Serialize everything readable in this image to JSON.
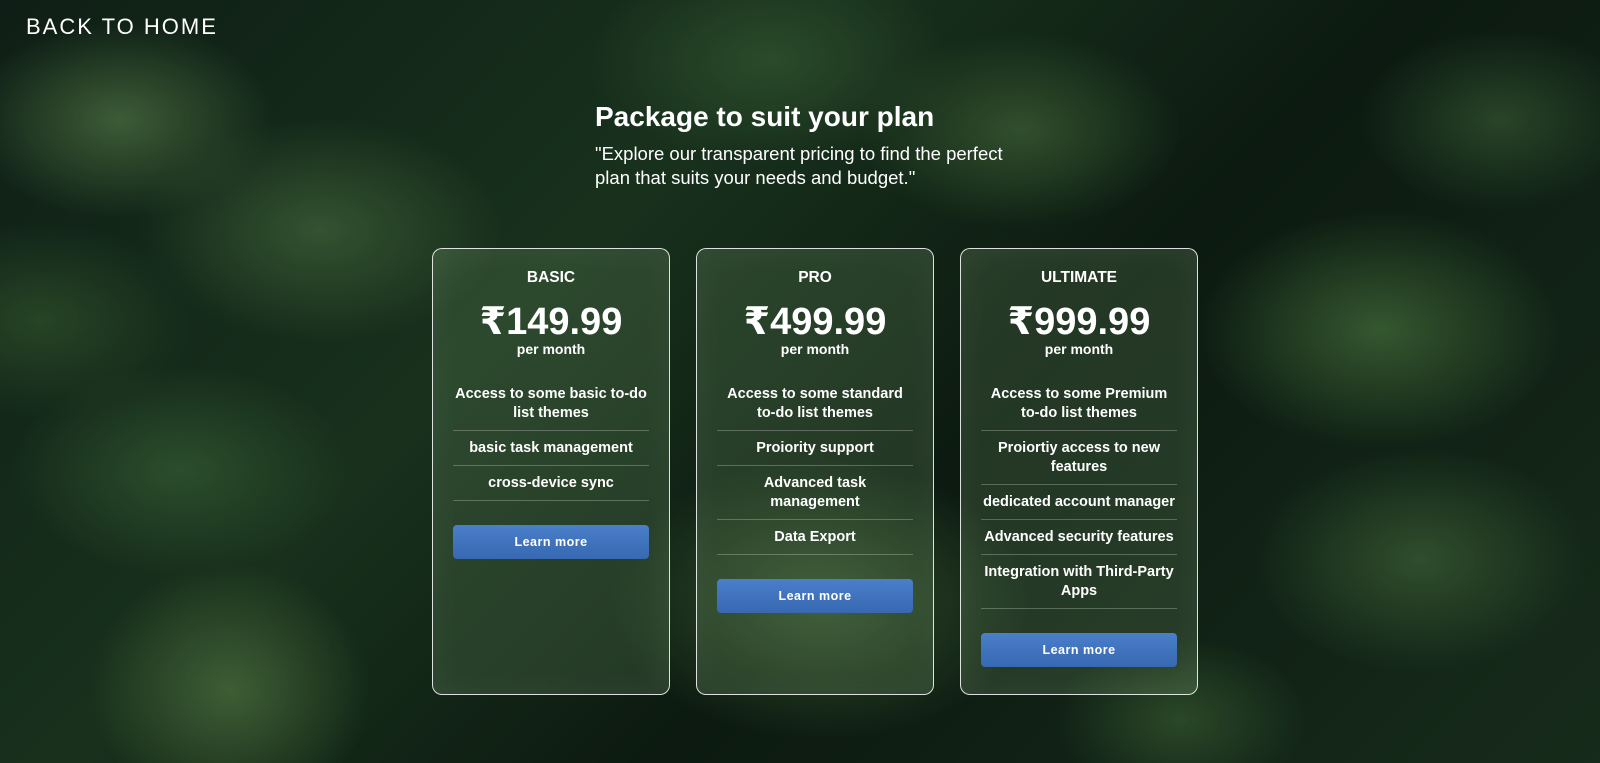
{
  "nav": {
    "back_home": "BACK TO HOME"
  },
  "header": {
    "title": "Package to suit your plan",
    "subtitle": "\"Explore our transparent pricing to find the perfect plan that suits your needs and budget.\""
  },
  "plans": [
    {
      "name": "BASIC",
      "price": "₹149.99",
      "period": "per month",
      "features": [
        "Access to some basic to-do list themes",
        "basic task management",
        "cross-device sync"
      ],
      "button": "Learn more"
    },
    {
      "name": "PRO",
      "price": "₹499.99",
      "period": "per month",
      "features": [
        "Access to some standard to-do list themes",
        "Proiority support",
        "Advanced task management",
        "Data Export"
      ],
      "button": "Learn more"
    },
    {
      "name": "ULTIMATE",
      "price": "₹999.99",
      "period": "per month",
      "features": [
        "Access to some Premium to-do list themes",
        "Proiortiy access to new features",
        "dedicated account manager",
        "Advanced security features",
        "Integration with Third-Party Apps"
      ],
      "button": "Learn more"
    }
  ],
  "colors": {
    "button": "#3b6fbf",
    "text": "#ffffff"
  }
}
